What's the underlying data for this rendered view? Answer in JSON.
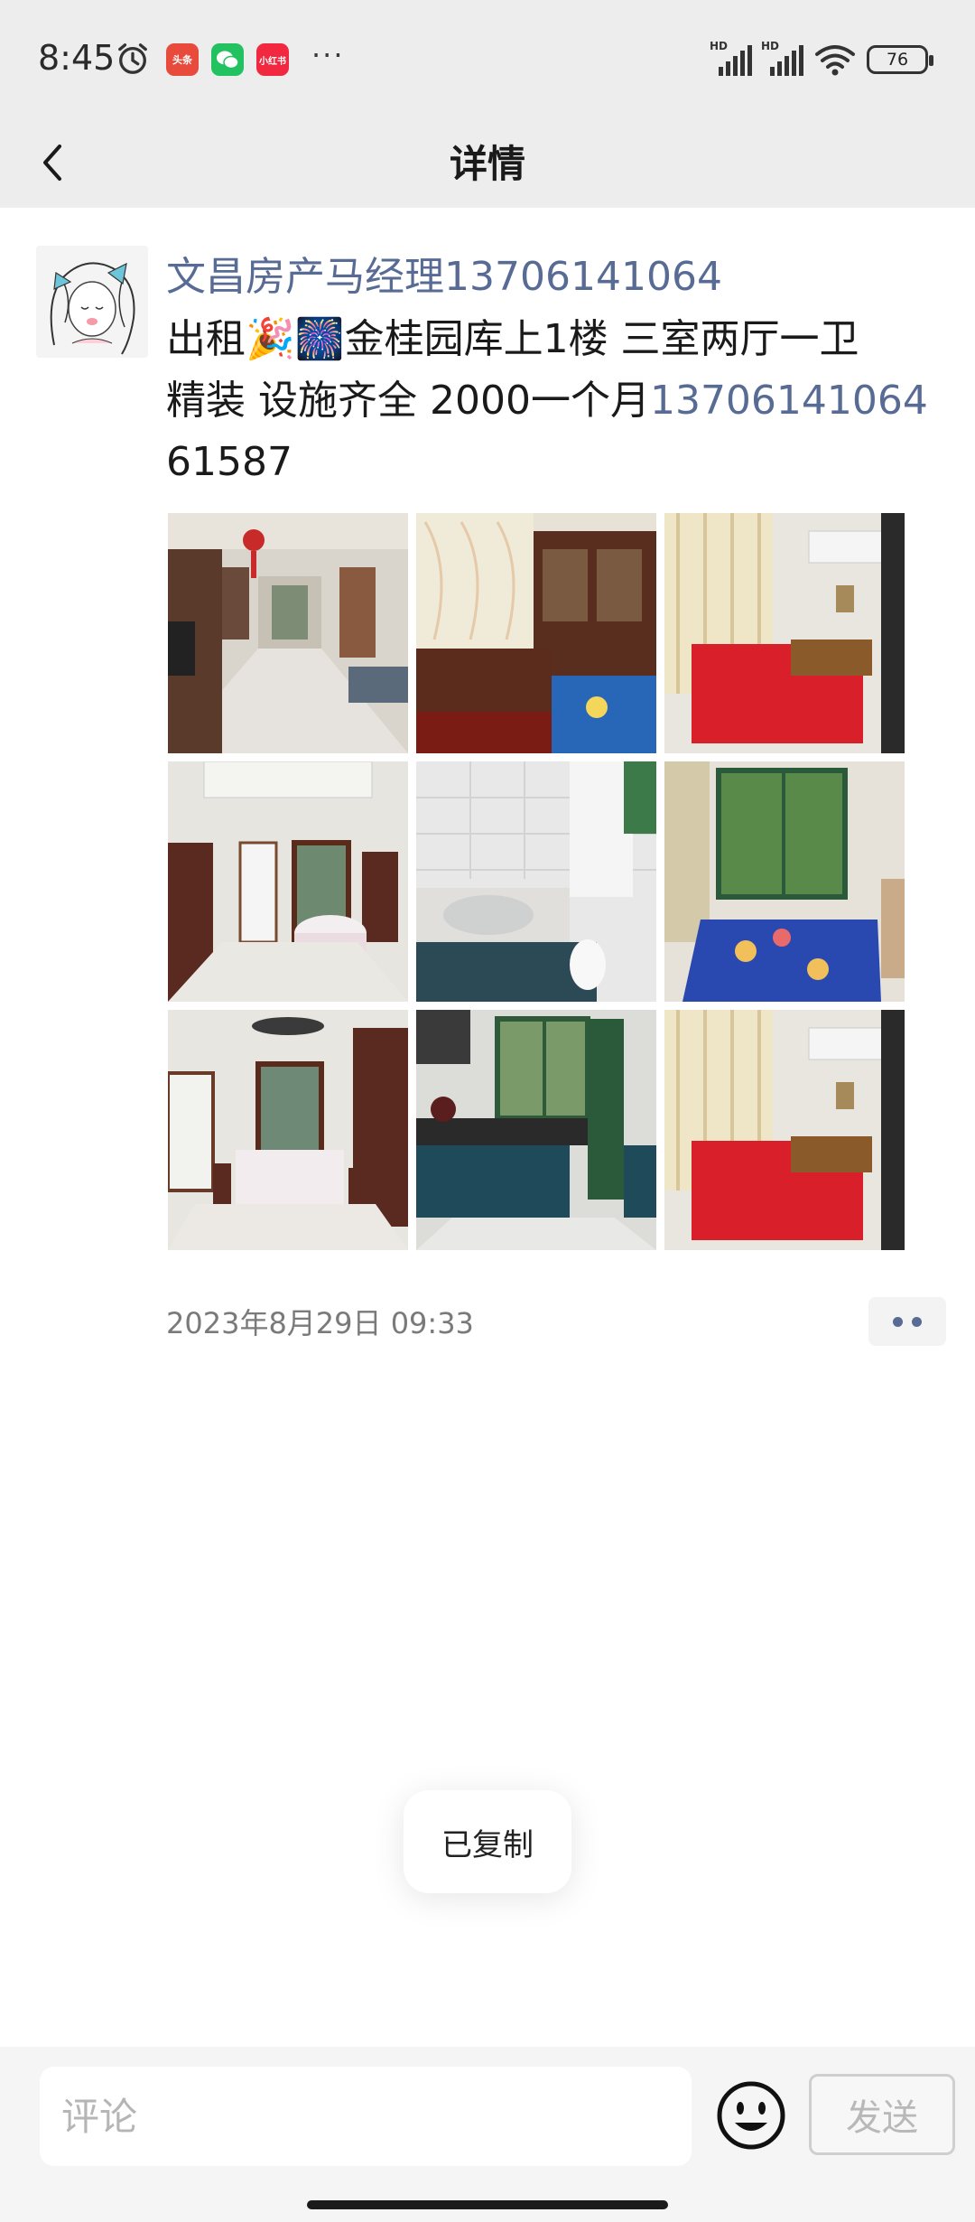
{
  "status_bar": {
    "time": "8:45",
    "battery": "76",
    "apps": [
      {
        "name": "toutiao-app-icon",
        "label": "头条",
        "color": "#e84a3c"
      },
      {
        "name": "wechat-app-icon",
        "label": "",
        "color": "#21c25f"
      },
      {
        "name": "xiaohongshu-app-icon",
        "label": "小红书",
        "color": "#f1283f"
      }
    ],
    "more": "···"
  },
  "header": {
    "title": "详情"
  },
  "post": {
    "author": "文昌房产马经理13706141064",
    "line1": "出租🎉🎆金桂园库上1楼  三室两厅一卫",
    "line2_text": "精装  设施齐全  2000一个月",
    "line2_phone": "13706141064",
    "line3": "61587",
    "timestamp": "2023年8月29日 09:33"
  },
  "toast": {
    "text": "已复制"
  },
  "comment_bar": {
    "placeholder": "评论",
    "send_label": "发送"
  }
}
